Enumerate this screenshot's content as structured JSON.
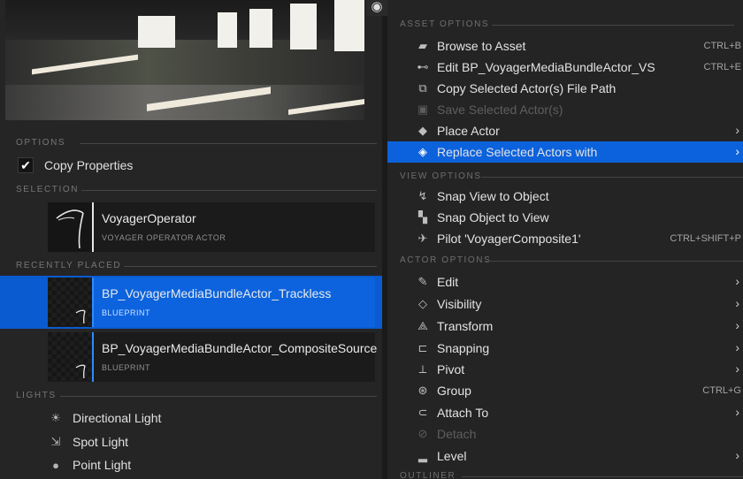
{
  "left_panel": {
    "sections": {
      "options": "OPTIONS",
      "selection": "SELECTION",
      "recently_placed": "RECENTLY PLACED",
      "lights": "LIGHTS"
    },
    "copy_properties": {
      "label": "Copy Properties",
      "checked": true
    },
    "selection_asset": {
      "name": "VoyagerOperator",
      "type": "VOYAGER OPERATOR ACTOR"
    },
    "recent_assets": [
      {
        "name": "BP_VoyagerMediaBundleActor_Trackless",
        "type": "BLUEPRINT",
        "selected": true
      },
      {
        "name": "BP_VoyagerMediaBundleActor_CompositeSource",
        "type": "BLUEPRINT",
        "selected": false
      }
    ],
    "lights": [
      {
        "label": "Directional Light",
        "icon": "directional-light-icon"
      },
      {
        "label": "Spot Light",
        "icon": "spot-light-icon"
      },
      {
        "label": "Point Light",
        "icon": "point-light-icon"
      }
    ]
  },
  "menu": {
    "asset_options_header": "ASSET OPTIONS",
    "view_options_header": "VIEW OPTIONS",
    "actor_options_header": "ACTOR OPTIONS",
    "outliner_header": "OUTLINER",
    "asset_options": [
      {
        "label": "Browse to Asset",
        "shortcut": "CTRL+B",
        "icon": "folder-icon"
      },
      {
        "label": "Edit BP_VoyagerMediaBundleActor_VS",
        "shortcut": "CTRL+E",
        "icon": "edit-blueprint-icon"
      },
      {
        "label": "Copy Selected Actor(s) File Path",
        "shortcut": "",
        "icon": "copy-path-icon"
      },
      {
        "label": "Save Selected Actor(s)",
        "shortcut": "",
        "icon": "save-icon",
        "disabled": true
      },
      {
        "label": "Place Actor",
        "submenu": true,
        "icon": "place-actor-icon"
      },
      {
        "label": "Replace Selected Actors with",
        "submenu": true,
        "icon": "replace-actors-icon",
        "highlighted": true
      }
    ],
    "view_options": [
      {
        "label": "Snap View to Object",
        "shortcut": "",
        "icon": "snap-view-icon"
      },
      {
        "label": "Snap Object to View",
        "shortcut": "",
        "icon": "snap-object-icon"
      },
      {
        "label": "Pilot 'VoyagerComposite1'",
        "shortcut": "CTRL+SHIFT+P",
        "icon": "pilot-icon"
      }
    ],
    "actor_options": [
      {
        "label": "Edit",
        "submenu": true,
        "icon": "edit-icon"
      },
      {
        "label": "Visibility",
        "submenu": true,
        "icon": "visibility-icon"
      },
      {
        "label": "Transform",
        "submenu": true,
        "icon": "transform-icon"
      },
      {
        "label": "Snapping",
        "submenu": true,
        "icon": "snapping-icon"
      },
      {
        "label": "Pivot",
        "submenu": true,
        "icon": "pivot-icon"
      },
      {
        "label": "Group",
        "shortcut": "CTRL+G",
        "icon": "group-icon"
      },
      {
        "label": "Attach To",
        "submenu": true,
        "icon": "attach-icon"
      },
      {
        "label": "Detach",
        "disabled": true,
        "icon": "detach-icon"
      },
      {
        "label": "Level",
        "submenu": true,
        "icon": "level-icon"
      }
    ]
  },
  "colors": {
    "highlight": "#0c62dc",
    "panel_bg": "#252525",
    "menu_bg": "#242424"
  }
}
